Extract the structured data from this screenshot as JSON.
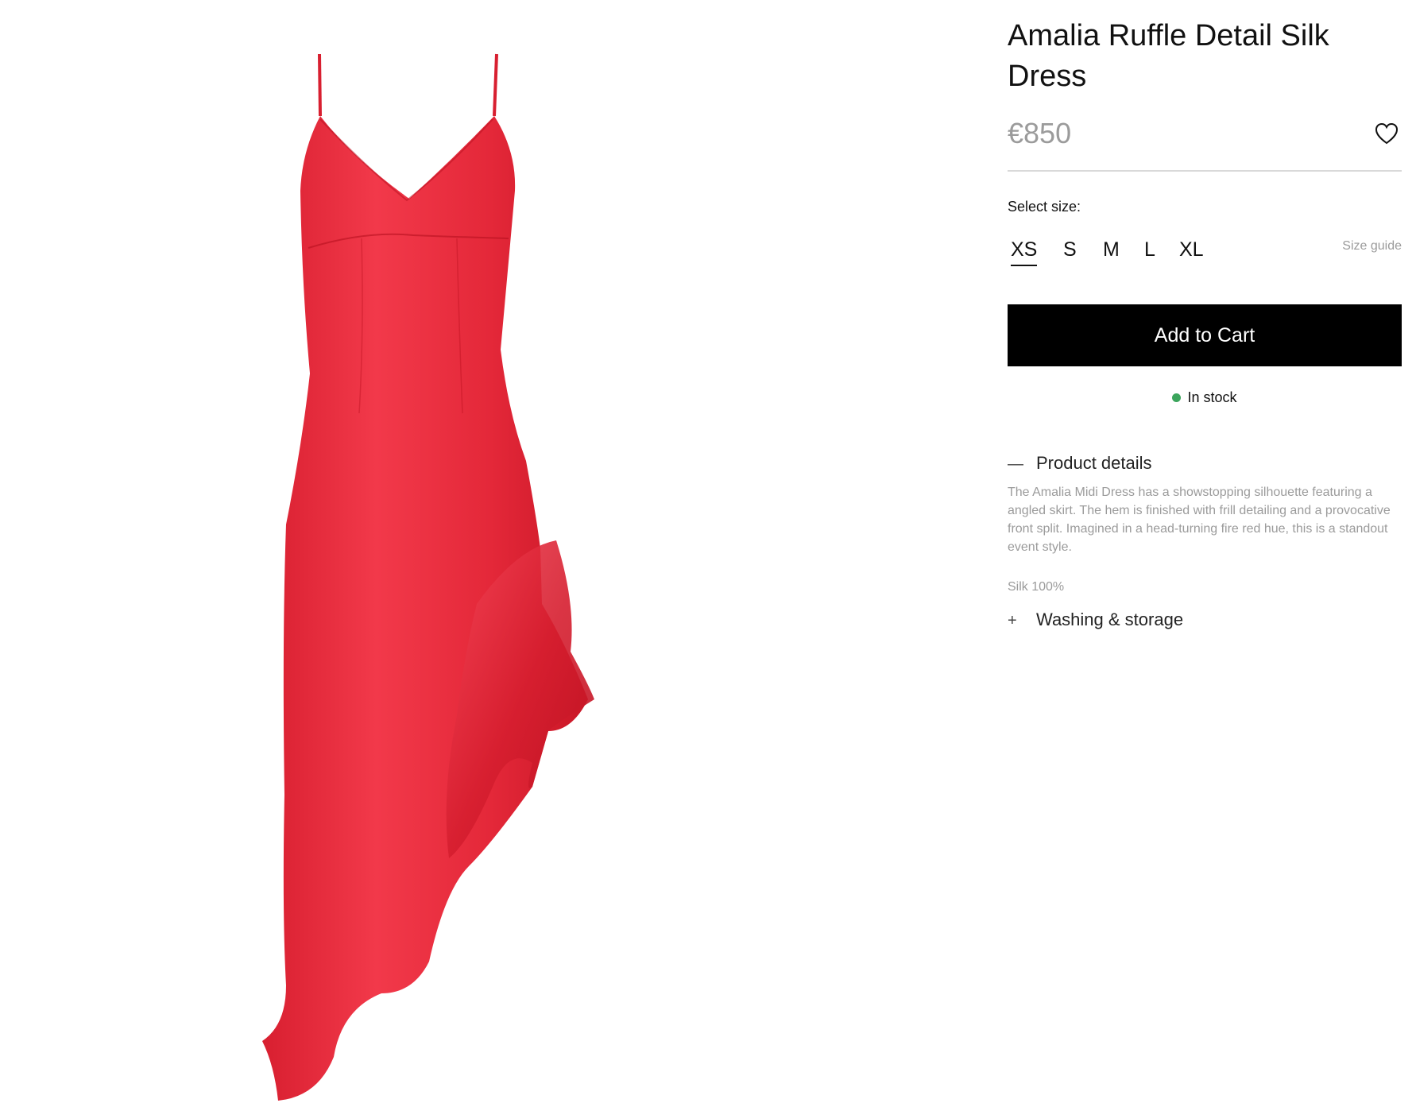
{
  "product": {
    "title": "Amalia Ruffle Detail Silk Dress",
    "price": "€850",
    "image_alt": "red silk dress with asymmetric ruffle hem",
    "color": "#e8323f"
  },
  "wishlist": {
    "icon": "heart-outline-icon"
  },
  "sizes": {
    "label": "Select size:",
    "options": [
      "XS",
      "S",
      "M",
      "L",
      "XL"
    ],
    "selected": "XS",
    "guide_label": "Size guide"
  },
  "cart": {
    "button_label": "Add to Cart",
    "stock_text": "In stock",
    "stock_color": "#3ba55c"
  },
  "accordion": {
    "details": {
      "icon": "—",
      "title": "Product details",
      "description": "The Amalia Midi Dress has a showstopping silhouette featuring a angled skirt. The hem is finished with frill detailing and a provocative front split. Imagined in a head-turning fire red hue, this is a standout event style.",
      "material": "Silk 100%"
    },
    "washing": {
      "icon": "+",
      "title": "Washing & storage"
    }
  }
}
